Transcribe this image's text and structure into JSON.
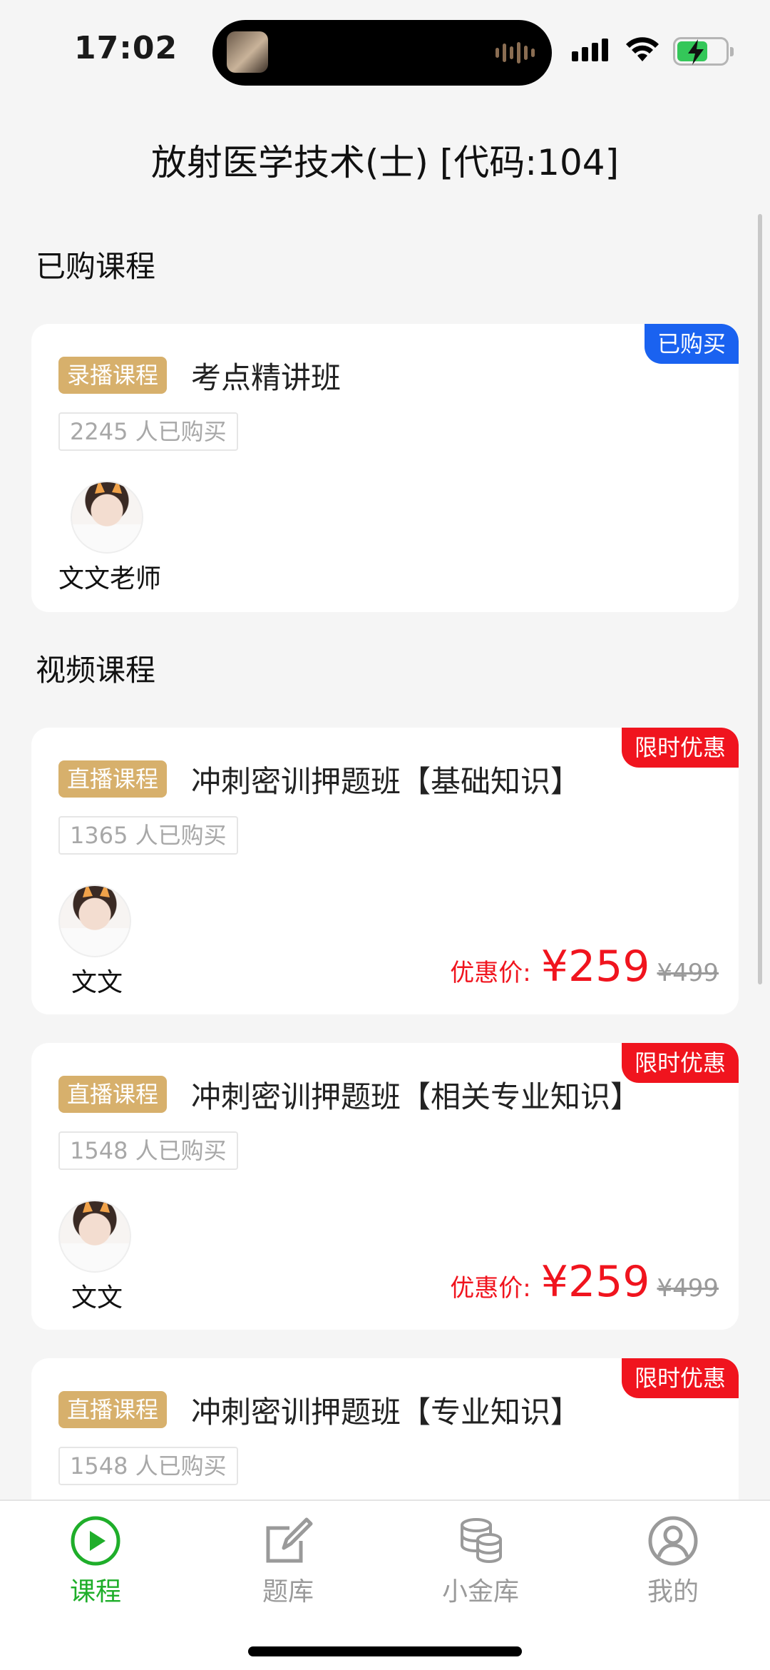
{
  "status_bar": {
    "time": "17:02"
  },
  "header": {
    "title": "放射医学技术(士) [代码:104]"
  },
  "sections": {
    "purchased": "已购课程",
    "video": "视频课程"
  },
  "purchased_course": {
    "badge": "已购买",
    "type": "录播课程",
    "name": "考点精讲班",
    "buyers": "2245 人已购买",
    "teacher": "文文老师"
  },
  "video_courses": [
    {
      "badge": "限时优惠",
      "type": "直播课程",
      "name": "冲刺密训押题班【基础知识】",
      "buyers": "1365 人已购买",
      "teacher": "文文",
      "price_label": "优惠价:",
      "price": "¥259",
      "original_price": "¥499"
    },
    {
      "badge": "限时优惠",
      "type": "直播课程",
      "name": "冲刺密训押题班【相关专业知识】",
      "buyers": "1548 人已购买",
      "teacher": "文文",
      "price_label": "优惠价:",
      "price": "¥259",
      "original_price": "¥499"
    },
    {
      "badge": "限时优惠",
      "type": "直播课程",
      "name": "冲刺密训押题班【专业知识】",
      "buyers": "1548 人已购买"
    }
  ],
  "tab_bar": [
    {
      "label": "课程",
      "icon": "play-circle-icon",
      "active": true
    },
    {
      "label": "题库",
      "icon": "edit-icon",
      "active": false
    },
    {
      "label": "小金库",
      "icon": "database-icon",
      "active": false
    },
    {
      "label": "我的",
      "icon": "user-icon",
      "active": false
    }
  ],
  "colors": {
    "accent_green": "#1fae2a",
    "tag_gold": "#d7b06c",
    "price_red": "#f0141e",
    "badge_blue": "#1a62f0"
  }
}
